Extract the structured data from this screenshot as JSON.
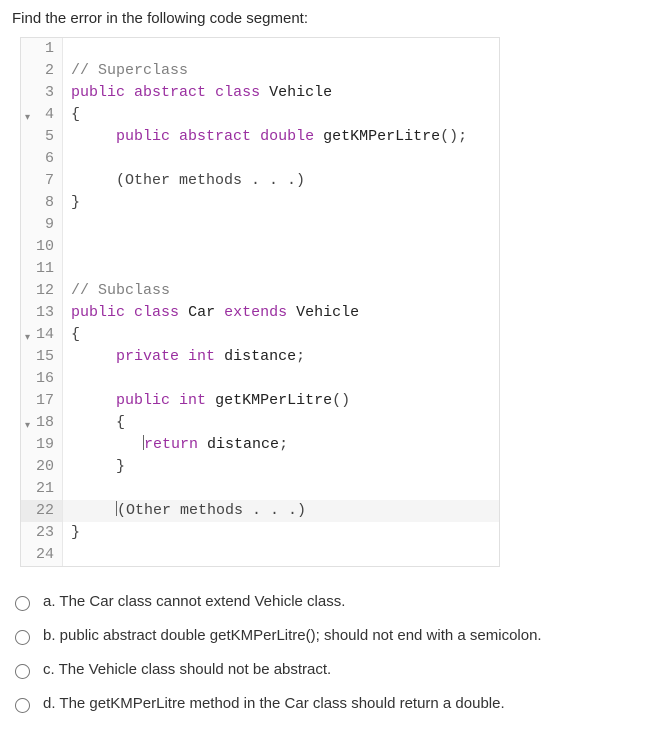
{
  "question": "Find the error in the following code segment:",
  "code": [
    {
      "n": "1",
      "caret": false,
      "hl": false,
      "tokens": []
    },
    {
      "n": "2",
      "caret": false,
      "hl": false,
      "tokens": [
        {
          "t": "comment",
          "v": "// Superclass"
        }
      ]
    },
    {
      "n": "3",
      "caret": false,
      "hl": false,
      "tokens": [
        {
          "t": "kw",
          "v": "public"
        },
        {
          "t": "sp",
          "v": " "
        },
        {
          "t": "kw",
          "v": "abstract"
        },
        {
          "t": "sp",
          "v": " "
        },
        {
          "t": "kw",
          "v": "class"
        },
        {
          "t": "sp",
          "v": " "
        },
        {
          "t": "ident",
          "v": "Vehicle"
        }
      ]
    },
    {
      "n": "4",
      "caret": true,
      "hl": false,
      "tokens": [
        {
          "t": "punct",
          "v": "{"
        }
      ]
    },
    {
      "n": "5",
      "caret": false,
      "hl": false,
      "tokens": [
        {
          "t": "indent",
          "v": "     "
        },
        {
          "t": "kw",
          "v": "public"
        },
        {
          "t": "sp",
          "v": " "
        },
        {
          "t": "kw",
          "v": "abstract"
        },
        {
          "t": "sp",
          "v": " "
        },
        {
          "t": "kw",
          "v": "double"
        },
        {
          "t": "sp",
          "v": " "
        },
        {
          "t": "ident",
          "v": "getKMPerLitre"
        },
        {
          "t": "punct",
          "v": "();"
        }
      ]
    },
    {
      "n": "6",
      "caret": false,
      "hl": false,
      "tokens": []
    },
    {
      "n": "7",
      "caret": false,
      "hl": false,
      "tokens": [
        {
          "t": "indent",
          "v": "     "
        },
        {
          "t": "punct",
          "v": "(Other methods . . .)"
        }
      ]
    },
    {
      "n": "8",
      "caret": false,
      "hl": false,
      "tokens": [
        {
          "t": "punct",
          "v": "}"
        }
      ]
    },
    {
      "n": "9",
      "caret": false,
      "hl": false,
      "tokens": []
    },
    {
      "n": "10",
      "caret": false,
      "hl": false,
      "tokens": []
    },
    {
      "n": "11",
      "caret": false,
      "hl": false,
      "tokens": []
    },
    {
      "n": "12",
      "caret": false,
      "hl": false,
      "tokens": [
        {
          "t": "comment",
          "v": "// Subclass"
        }
      ]
    },
    {
      "n": "13",
      "caret": false,
      "hl": false,
      "tokens": [
        {
          "t": "kw",
          "v": "public"
        },
        {
          "t": "sp",
          "v": " "
        },
        {
          "t": "kw",
          "v": "class"
        },
        {
          "t": "sp",
          "v": " "
        },
        {
          "t": "ident",
          "v": "Car"
        },
        {
          "t": "sp",
          "v": " "
        },
        {
          "t": "kw",
          "v": "extends"
        },
        {
          "t": "sp",
          "v": " "
        },
        {
          "t": "ident",
          "v": "Vehicle"
        }
      ]
    },
    {
      "n": "14",
      "caret": true,
      "hl": false,
      "tokens": [
        {
          "t": "punct",
          "v": "{"
        }
      ]
    },
    {
      "n": "15",
      "caret": false,
      "hl": false,
      "tokens": [
        {
          "t": "indent",
          "v": "     "
        },
        {
          "t": "kw",
          "v": "private"
        },
        {
          "t": "sp",
          "v": " "
        },
        {
          "t": "kw",
          "v": "int"
        },
        {
          "t": "sp",
          "v": " "
        },
        {
          "t": "ident",
          "v": "distance"
        },
        {
          "t": "punct",
          "v": ";"
        }
      ]
    },
    {
      "n": "16",
      "caret": false,
      "hl": false,
      "tokens": []
    },
    {
      "n": "17",
      "caret": false,
      "hl": false,
      "tokens": [
        {
          "t": "indent",
          "v": "     "
        },
        {
          "t": "kw",
          "v": "public"
        },
        {
          "t": "sp",
          "v": " "
        },
        {
          "t": "kw",
          "v": "int"
        },
        {
          "t": "sp",
          "v": " "
        },
        {
          "t": "ident",
          "v": "getKMPerLitre"
        },
        {
          "t": "punct",
          "v": "()"
        }
      ]
    },
    {
      "n": "18",
      "caret": true,
      "hl": false,
      "tokens": [
        {
          "t": "indent",
          "v": "     "
        },
        {
          "t": "punct",
          "v": "{"
        }
      ]
    },
    {
      "n": "19",
      "caret": false,
      "hl": false,
      "tokens": [
        {
          "t": "indent",
          "v": "        "
        },
        {
          "t": "cursor",
          "v": ""
        },
        {
          "t": "kw",
          "v": "return"
        },
        {
          "t": "sp",
          "v": " "
        },
        {
          "t": "ident",
          "v": "distance"
        },
        {
          "t": "punct",
          "v": ";"
        }
      ]
    },
    {
      "n": "20",
      "caret": false,
      "hl": false,
      "tokens": [
        {
          "t": "indent",
          "v": "     "
        },
        {
          "t": "punct",
          "v": "}"
        }
      ]
    },
    {
      "n": "21",
      "caret": false,
      "hl": false,
      "tokens": []
    },
    {
      "n": "22",
      "caret": false,
      "hl": true,
      "tokens": [
        {
          "t": "indent",
          "v": "     "
        },
        {
          "t": "cursor",
          "v": ""
        },
        {
          "t": "punct",
          "v": "(Other methods . . .)"
        }
      ]
    },
    {
      "n": "23",
      "caret": false,
      "hl": false,
      "tokens": [
        {
          "t": "punct",
          "v": "}"
        }
      ]
    },
    {
      "n": "24",
      "caret": false,
      "hl": false,
      "tokens": []
    }
  ],
  "options": [
    {
      "key": "a",
      "text": "a. The Car class cannot extend Vehicle class."
    },
    {
      "key": "b",
      "text": "b. public abstract double getKMPerLitre(); should not end with a semicolon."
    },
    {
      "key": "c",
      "text": "c. The Vehicle class should not be abstract."
    },
    {
      "key": "d",
      "text": "d. The getKMPerLitre method in the Car class should return a double."
    }
  ]
}
